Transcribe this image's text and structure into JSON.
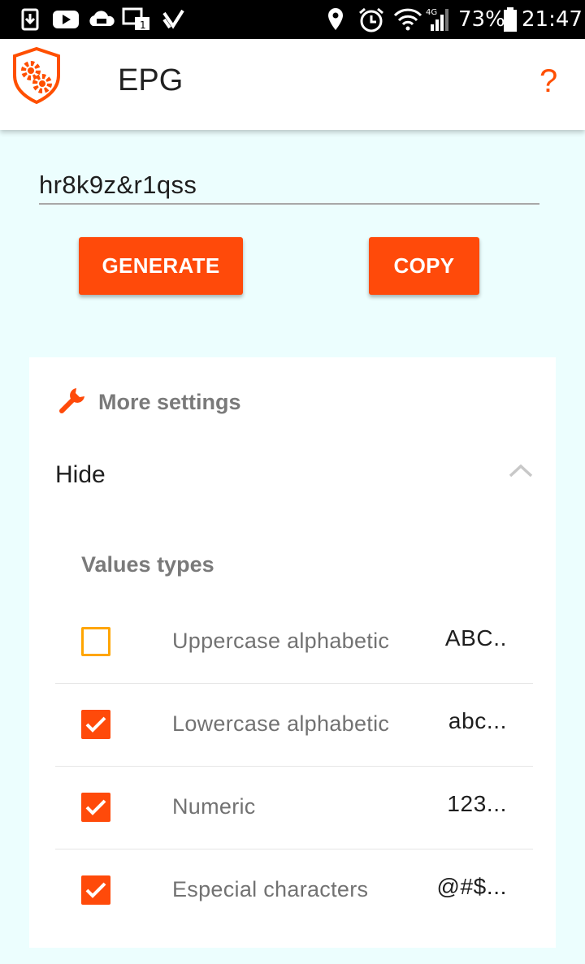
{
  "status_bar": {
    "battery_percent": "73%",
    "time": "21:47",
    "network": "4G",
    "icons": [
      "download-icon",
      "youtube-icon",
      "cloud-game-icon",
      "message-icon",
      "check-app-icon",
      "location-icon",
      "alarm-icon",
      "wifi-icon",
      "signal-icon",
      "battery-icon"
    ]
  },
  "app_bar": {
    "title": "EPG",
    "help_label": "?",
    "logo_icon": "gears-shield-icon"
  },
  "password": {
    "value": "hr8k9z&r1qss"
  },
  "actions": {
    "generate_label": "GENERATE",
    "copy_label": "COPY"
  },
  "settings": {
    "header_label": "More settings",
    "header_icon": "wrench-icon",
    "toggle_label": "Hide",
    "toggle_icon": "chevron-up-icon",
    "section_label": "Values types",
    "options": [
      {
        "label": "Uppercase alphabetic",
        "sample": "ABC..",
        "checked": false
      },
      {
        "label": "Lowercase alphabetic",
        "sample": "abc...",
        "checked": true
      },
      {
        "label": "Numeric",
        "sample": "123...",
        "checked": true
      },
      {
        "label": "Especial characters",
        "sample": "@#$...",
        "checked": true
      }
    ]
  },
  "colors": {
    "accent": "#ff4a0a",
    "unchecked_border": "#ffa500",
    "background": "#ecfefe"
  }
}
